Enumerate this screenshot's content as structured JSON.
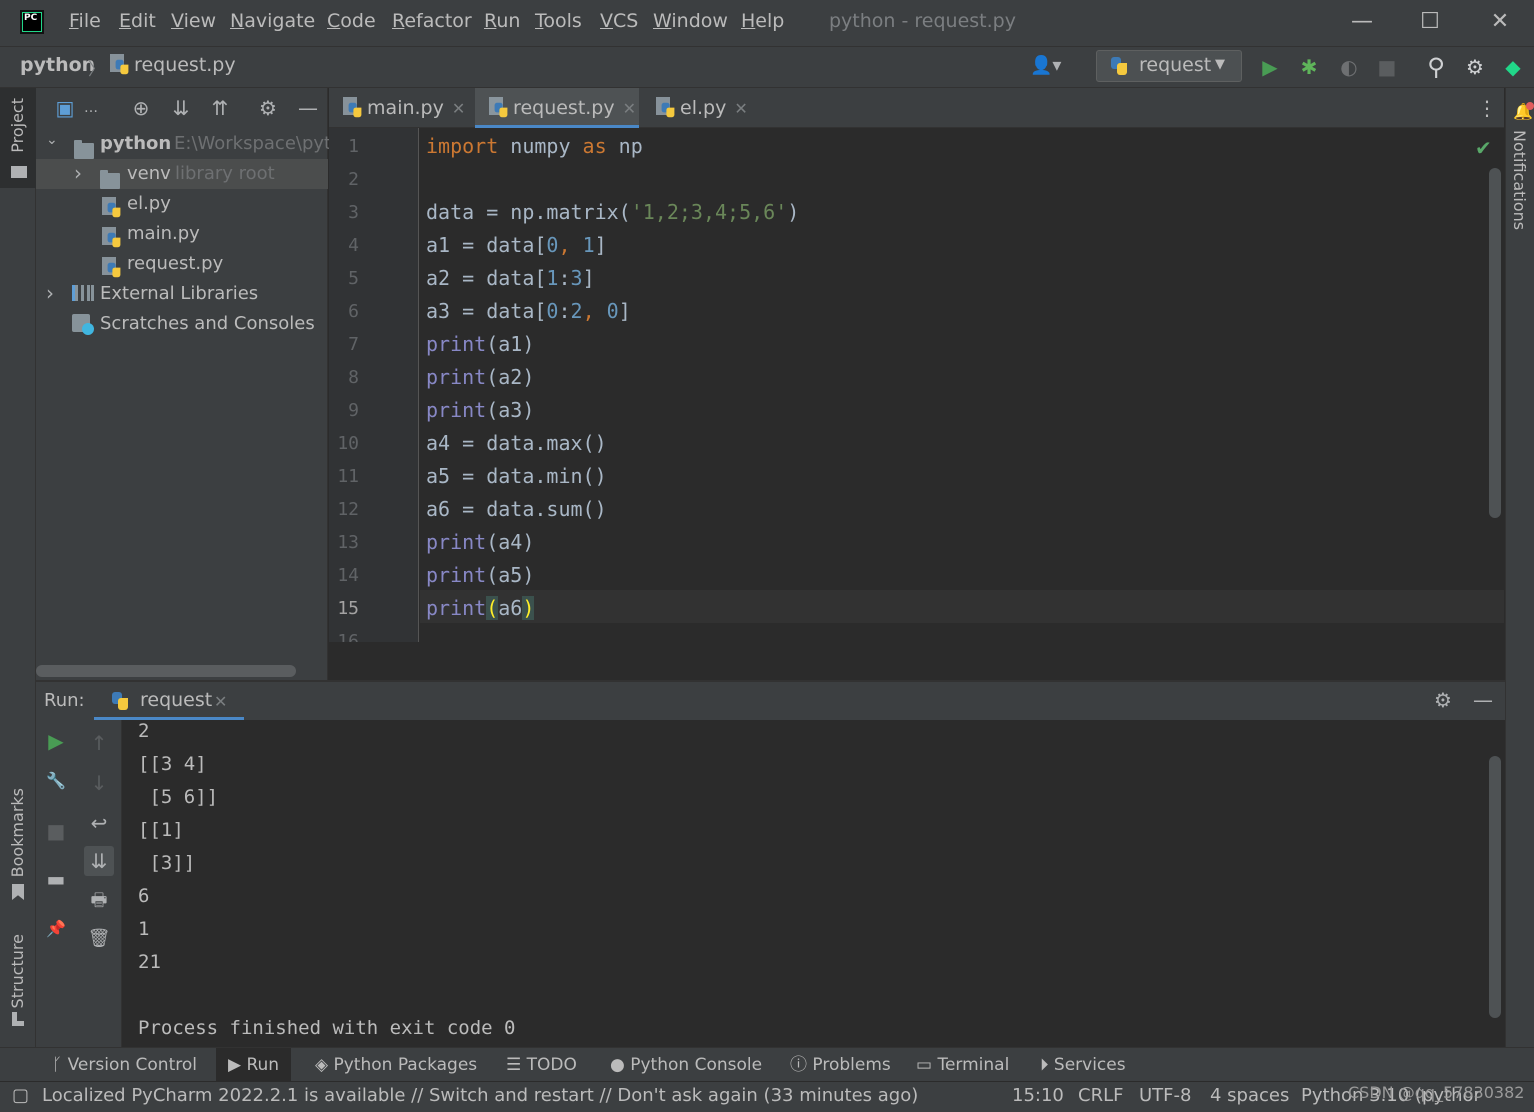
{
  "titlebar": {
    "menu": [
      "File",
      "Edit",
      "View",
      "Navigate",
      "Code",
      "Refactor",
      "Run",
      "Tools",
      "VCS",
      "Window",
      "Help"
    ],
    "window_title": "python - request.py",
    "minimize": "—",
    "maximize": "☐",
    "close": "✕"
  },
  "navbar": {
    "project": "python",
    "separator": "〉",
    "file": "request.py",
    "run_config": "request",
    "user_icon": "👤▾",
    "run_icon": "▶",
    "debug_icon": "✱",
    "coverage_icon": "◐",
    "stop_icon": "■",
    "search_icon": "⚲",
    "settings_icon": "⚙",
    "jetbrains_icon": "◆"
  },
  "left_strip": {
    "project_tab": "Project",
    "bookmarks_tab": "Bookmarks",
    "structure_tab": "Structure"
  },
  "right_strip": {
    "notifications_tab": "Notifications"
  },
  "project_panel": {
    "tools": [
      "▣",
      "…",
      "⊕",
      "⇊",
      "⇈",
      "⚙",
      "—"
    ],
    "tree": [
      {
        "name": "python",
        "hint": "E:\\Workspace\\pyt",
        "arrow": "⌄"
      },
      {
        "name": "venv",
        "hint": "library root",
        "arrow": "›"
      },
      {
        "name": "el.py"
      },
      {
        "name": "main.py"
      },
      {
        "name": "request.py"
      },
      {
        "name": "External Libraries",
        "arrow": "›"
      },
      {
        "name": "Scratches and Consoles"
      }
    ]
  },
  "editor": {
    "tabs": [
      {
        "label": "main.py",
        "close": "✕"
      },
      {
        "label": "request.py",
        "close": "✕"
      },
      {
        "label": "el.py",
        "close": "✕"
      }
    ],
    "more_icon": "⋮",
    "check_icon": "✔",
    "line_numbers": [
      "1",
      "2",
      "3",
      "4",
      "5",
      "6",
      "7",
      "8",
      "9",
      "10",
      "11",
      "12",
      "13",
      "14",
      "15",
      "16"
    ]
  },
  "run_panel": {
    "label": "Run:",
    "tab": "request",
    "tab_close": "✕",
    "settings_icon": "⚙",
    "hide_icon": "—",
    "tools_col1": [
      "▶",
      "🔧",
      "■",
      "▬",
      "📌"
    ],
    "tools_col2": [
      "↑",
      "↓",
      "↩",
      "⇊",
      "🖶",
      "🗑"
    ],
    "output": [
      "2",
      "[[3 4]",
      " [5 6]]",
      "[[1]",
      " [3]]",
      "6",
      "1",
      "21",
      "",
      "Process finished with exit code 0"
    ]
  },
  "bottom_tools": [
    {
      "icon": "ᚴ",
      "label": "Version Control"
    },
    {
      "icon": "▶",
      "label": "Run"
    },
    {
      "icon": "◈",
      "label": "Python Packages"
    },
    {
      "icon": "☰",
      "label": "TODO"
    },
    {
      "icon": "●",
      "label": "Python Console"
    },
    {
      "icon": "ⓘ",
      "label": "Problems"
    },
    {
      "icon": "▭",
      "label": "Terminal"
    },
    {
      "icon": "⏵",
      "label": "Services"
    }
  ],
  "statusbar": {
    "icon": "▢",
    "message": "Localized PyCharm 2022.2.1 is available // Switch and restart // Don't ask again (33 minutes ago)",
    "position": "15:10",
    "line_sep": "CRLF",
    "encoding": "UTF-8",
    "indent": "4 spaces",
    "interpreter": "Python 3.10 (python)",
    "watermark": "CSDN @qq_57830382"
  }
}
